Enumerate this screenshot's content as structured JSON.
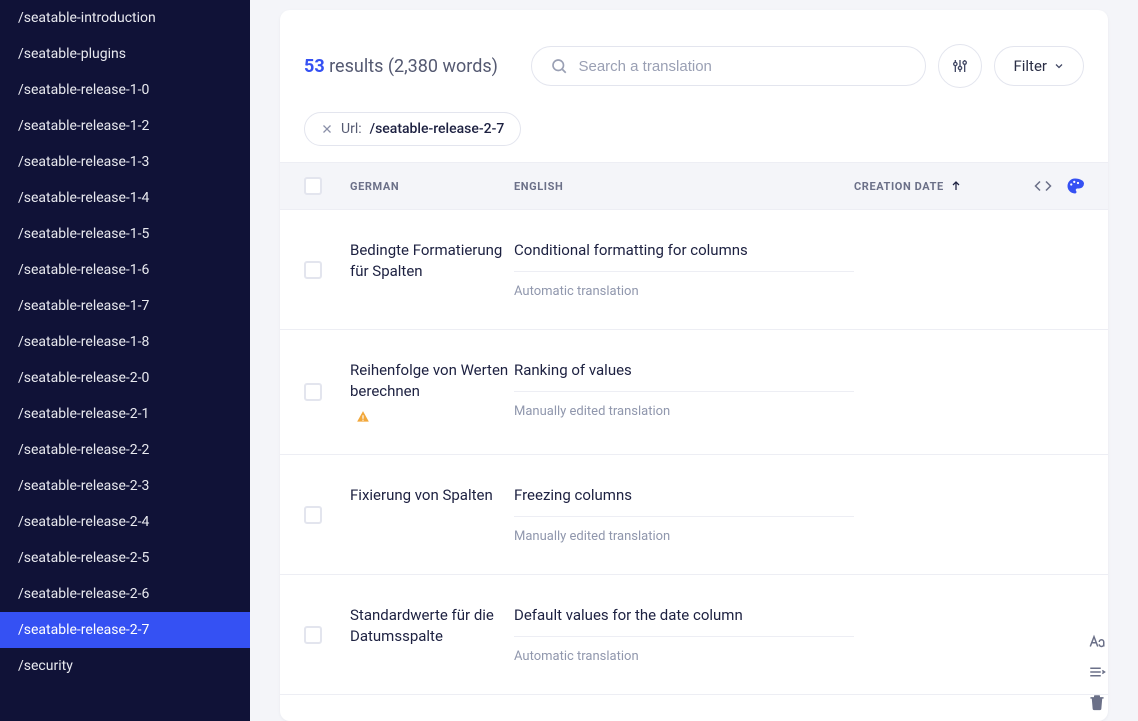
{
  "sidebar": {
    "items": [
      {
        "label": "/seatable-introduction",
        "active": false
      },
      {
        "label": "/seatable-plugins",
        "active": false
      },
      {
        "label": "/seatable-release-1-0",
        "active": false
      },
      {
        "label": "/seatable-release-1-2",
        "active": false
      },
      {
        "label": "/seatable-release-1-3",
        "active": false
      },
      {
        "label": "/seatable-release-1-4",
        "active": false
      },
      {
        "label": "/seatable-release-1-5",
        "active": false
      },
      {
        "label": "/seatable-release-1-6",
        "active": false
      },
      {
        "label": "/seatable-release-1-7",
        "active": false
      },
      {
        "label": "/seatable-release-1-8",
        "active": false
      },
      {
        "label": "/seatable-release-2-0",
        "active": false
      },
      {
        "label": "/seatable-release-2-1",
        "active": false
      },
      {
        "label": "/seatable-release-2-2",
        "active": false
      },
      {
        "label": "/seatable-release-2-3",
        "active": false
      },
      {
        "label": "/seatable-release-2-4",
        "active": false
      },
      {
        "label": "/seatable-release-2-5",
        "active": false
      },
      {
        "label": "/seatable-release-2-6",
        "active": false
      },
      {
        "label": "/seatable-release-2-7",
        "active": true
      },
      {
        "label": "/security",
        "active": false
      }
    ]
  },
  "header": {
    "count": "53",
    "results_label": "results",
    "words": "(2,380 words)",
    "search_placeholder": "Search a translation",
    "filter_label": "Filter"
  },
  "chip": {
    "label": "Url:",
    "value": "/seatable-release-2-7"
  },
  "columns": {
    "german": "GERMAN",
    "english": "ENGLISH",
    "date": "CREATION DATE"
  },
  "rows": [
    {
      "german": "Bedingte Formatierung für Spalten",
      "english": "Conditional formatting for columns",
      "sub": "Automatic translation",
      "warn": false
    },
    {
      "german": "Reihenfolge von Werten berechnen",
      "english": "Ranking of values",
      "sub": "Manually edited translation",
      "warn": true
    },
    {
      "german": "Fixierung von Spalten",
      "english": "Freezing columns",
      "sub": "Manually edited translation",
      "warn": false
    },
    {
      "german": "Standardwerte für die Datumsspalte",
      "english": "Default values for the date column",
      "sub": "Automatic translation",
      "warn": false
    }
  ]
}
